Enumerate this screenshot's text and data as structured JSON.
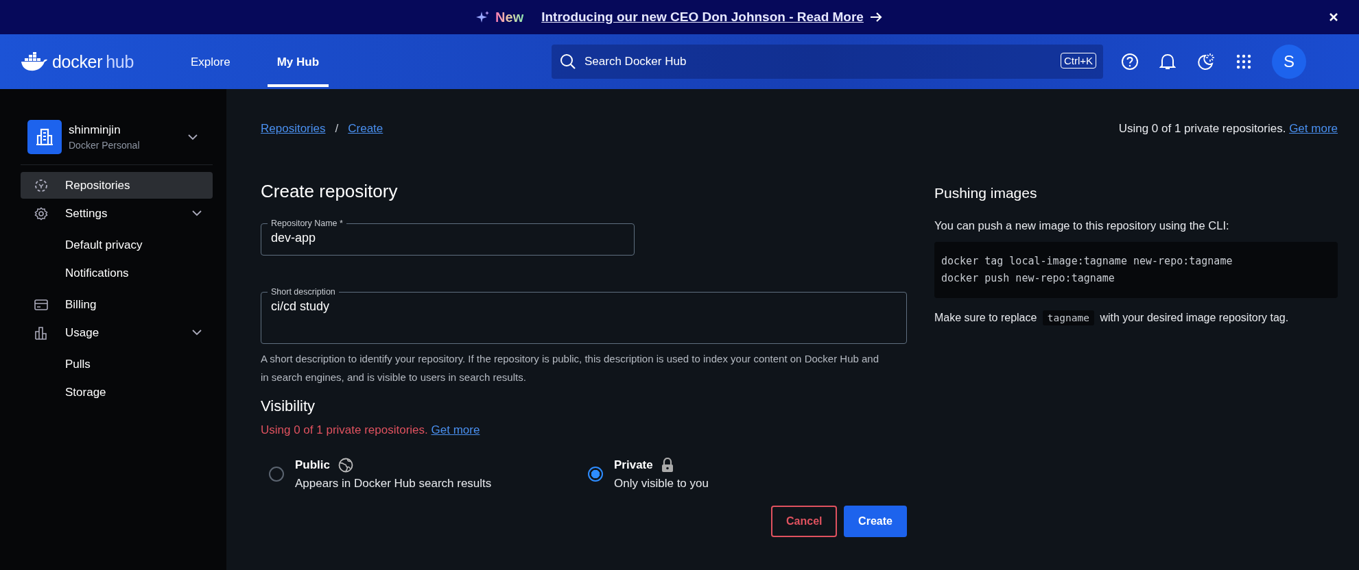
{
  "banner": {
    "badge": "New",
    "text": "Introducing our new CEO Don Johnson - Read More"
  },
  "header": {
    "logo": {
      "word": "docker",
      "product": "hub"
    },
    "nav": [
      {
        "label": "Explore",
        "selected": false
      },
      {
        "label": "My Hub",
        "selected": true
      }
    ],
    "search": {
      "placeholder": "Search Docker Hub",
      "shortcut": "Ctrl+K"
    },
    "avatar": "S"
  },
  "sidebar": {
    "account": {
      "name": "shinminjin",
      "plan": "Docker Personal"
    },
    "items": [
      {
        "label": "Repositories",
        "selected": true
      },
      {
        "label": "Settings",
        "selected": false,
        "expanded": true,
        "children": [
          {
            "label": "Default privacy",
            "selected": false
          },
          {
            "label": "Notifications",
            "selected": false
          }
        ]
      },
      {
        "label": "Billing",
        "selected": false
      },
      {
        "label": "Usage",
        "selected": false,
        "expanded": true,
        "children": [
          {
            "label": "Pulls",
            "selected": false
          },
          {
            "label": "Storage",
            "selected": false
          }
        ]
      }
    ]
  },
  "breadcrumb_separator": "/",
  "breadcrumb": [
    {
      "label": "Repositories"
    },
    {
      "label": "Create"
    }
  ],
  "usage_note": {
    "text": "Using 0 of 1 private repositories.",
    "link": "Get more"
  },
  "form": {
    "title": "Create repository",
    "name_field": {
      "label": "Repository Name *",
      "value": "dev-app"
    },
    "description_field": {
      "label": "Short description",
      "value": "ci/cd study"
    },
    "help": "A short description to identify your repository. If the repository is public, this description is used to index your content on Docker Hub and in search engines, and is visible to users in search results.",
    "visibility": {
      "title": "Visibility",
      "warning": "Using 0 of 1 private repositories.",
      "link": "Get more",
      "options": [
        {
          "label": "Public",
          "description": "Appears in Docker Hub search results",
          "selected": false
        },
        {
          "label": "Private",
          "description": "Only visible to you",
          "selected": true
        }
      ]
    },
    "buttons": [
      {
        "label": "Cancel",
        "kind": "secondary"
      },
      {
        "label": "Create",
        "kind": "primary"
      }
    ]
  },
  "push_panel": {
    "title": "Pushing images",
    "intro": "You can push a new image to this repository using the CLI:",
    "code": [
      "docker tag local-image:tagname new-repo:tagname",
      "docker push new-repo:tagname"
    ],
    "note": {
      "before": "Make sure to replace",
      "code": "tagname",
      "after": "with your desired image repository tag."
    }
  }
}
